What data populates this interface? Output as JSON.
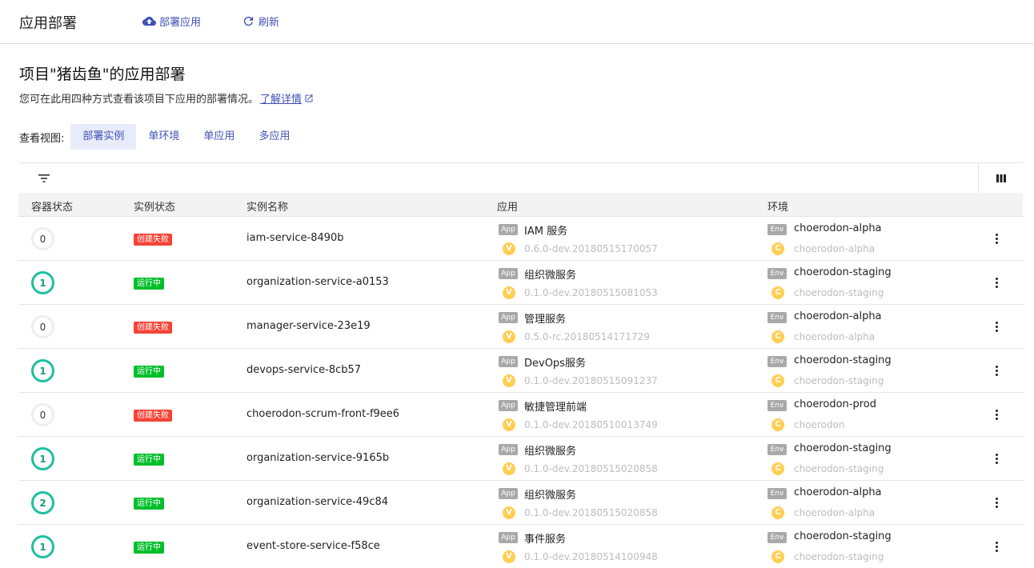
{
  "header": {
    "title": "应用部署",
    "deploy_label": "部署应用",
    "refresh_label": "刷新"
  },
  "page": {
    "heading": "项目\"猪齿鱼\"的应用部署",
    "description": "您可在此用四种方式查看该项目下应用的部署情况。",
    "learn_more": "了解详情"
  },
  "view": {
    "label": "查看视图:",
    "tabs": [
      "部署实例",
      "单环境",
      "单应用",
      "多应用"
    ],
    "active": "部署实例"
  },
  "table": {
    "columns": [
      "容器状态",
      "实例状态",
      "实例名称",
      "应用",
      "环境"
    ],
    "app_badge": "App",
    "env_badge": "Env",
    "version_glyph": "V",
    "env_glyph": "C",
    "rows": [
      {
        "containers": "0",
        "status": "创建失败",
        "status_type": "fail",
        "instance": "iam-service-8490b",
        "app": "IAM 服务",
        "version": "0.6.0-dev.20180515170057",
        "env": "choerodon-alpha",
        "env_sub": "choerodon-alpha"
      },
      {
        "containers": "1",
        "status": "运行中",
        "status_type": "ok",
        "instance": "organization-service-a0153",
        "app": "组织微服务",
        "version": "0.1.0-dev.20180515081053",
        "env": "choerodon-staging",
        "env_sub": "choerodon-staging"
      },
      {
        "containers": "0",
        "status": "创建失败",
        "status_type": "fail",
        "instance": "manager-service-23e19",
        "app": "管理服务",
        "version": "0.5.0-rc.20180514171729",
        "env": "choerodon-alpha",
        "env_sub": "choerodon-alpha"
      },
      {
        "containers": "1",
        "status": "运行中",
        "status_type": "ok",
        "instance": "devops-service-8cb57",
        "app": "DevOps服务",
        "version": "0.1.0-dev.20180515091237",
        "env": "choerodon-staging",
        "env_sub": "choerodon-staging"
      },
      {
        "containers": "0",
        "status": "创建失败",
        "status_type": "fail",
        "instance": "choerodon-scrum-front-f9ee6",
        "app": "敏捷管理前端",
        "version": "0.1.0-dev.20180510013749",
        "env": "choerodon-prod",
        "env_sub": "choerodon"
      },
      {
        "containers": "1",
        "status": "运行中",
        "status_type": "ok",
        "instance": "organization-service-9165b",
        "app": "组织微服务",
        "version": "0.1.0-dev.20180515020858",
        "env": "choerodon-staging",
        "env_sub": "choerodon-staging"
      },
      {
        "containers": "2",
        "status": "运行中",
        "status_type": "ok",
        "instance": "organization-service-49c84",
        "app": "组织微服务",
        "version": "0.1.0-dev.20180515020858",
        "env": "choerodon-alpha",
        "env_sub": "choerodon-alpha"
      },
      {
        "containers": "1",
        "status": "运行中",
        "status_type": "ok",
        "instance": "event-store-service-f58ce",
        "app": "事件服务",
        "version": "0.1.0-dev.20180514100948",
        "env": "choerodon-staging",
        "env_sub": "choerodon-staging"
      }
    ]
  },
  "colors": {
    "accent": "#3f51b5",
    "running": "#00bf2a",
    "failed": "#f44336",
    "ring": "#1fbfa0",
    "coin": "#ffce54"
  },
  "icons": {
    "deploy": "cloud-upload-icon",
    "refresh": "refresh-icon",
    "filter": "filter-icon",
    "columns": "column-toggle-icon",
    "external": "external-link-icon",
    "more": "more-vert-icon"
  }
}
